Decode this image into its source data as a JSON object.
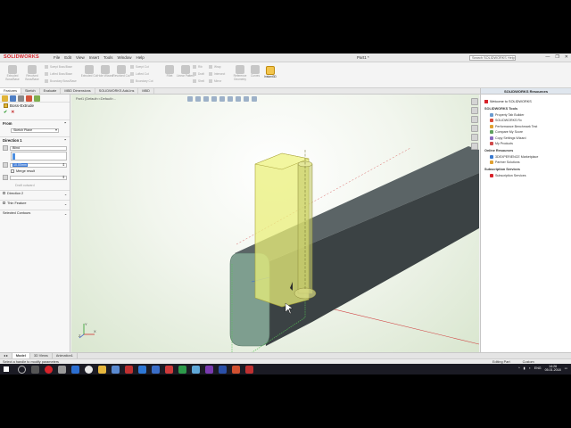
{
  "window": {
    "app_logo": "SOLIDWORKS",
    "menus": [
      "File",
      "Edit",
      "View",
      "Insert",
      "Tools",
      "Window",
      "Help"
    ],
    "doc_title": "Part1 *",
    "search_placeholder": "Search SOLIDWORKS Help",
    "controls": [
      "—",
      "❐",
      "✕"
    ]
  },
  "ribbon": {
    "groups": [
      {
        "label": "Extruded Boss/Base"
      },
      {
        "label": "Revolved Boss/Base"
      },
      {
        "label": "Extruded Cut"
      },
      {
        "label": "Hole Wizard"
      },
      {
        "label": "Revolved Cut"
      },
      {
        "label": "Fillet"
      },
      {
        "label": "Linear Pattern"
      },
      {
        "label": "Rib"
      },
      {
        "label": "Reference Geometry"
      },
      {
        "label": "Curves"
      }
    ],
    "small_items": [
      "Swept Boss/Base",
      "Lofted Boss/Base",
      "Boundary Boss/Base",
      "Swept Cut",
      "Lofted Cut",
      "Boundary Cut",
      "Draft",
      "Shell",
      "Wrap",
      "Intersect",
      "Mirror"
    ],
    "instant3d_label": "Instant3D"
  },
  "tabs": [
    "Features",
    "Sketch",
    "Evaluate",
    "MBD Dimensions",
    "SOLIDWORKS Add-Ins",
    "MBD"
  ],
  "active_tab": "Features",
  "property_manager": {
    "title": "Boss-Extrude",
    "ok": "✔",
    "cancel": "✕",
    "from_label": "From",
    "from_value": "Sketch Plane",
    "direction1_label": "Direction 1",
    "end_condition": "Blind",
    "depth_value": "10.00mm",
    "merge_result": "Merge result",
    "draft_outward": "Draft outward",
    "direction2_label": "Direction 2",
    "thin_feature_label": "Thin Feature",
    "selected_contours_label": "Selected Contours"
  },
  "graphics": {
    "breadcrumb": "Part1 (Default<<Default>...",
    "colors": {
      "bar_body": "#3b4244",
      "end_face": "#7e9e8f",
      "preview": "#e9ef7a",
      "preview_edge": "#a9a33a",
      "cylinder": "#c5c96a"
    },
    "axis_labels": {
      "x": "X",
      "y": "Y",
      "z": "Z"
    }
  },
  "resources": {
    "header": "SOLIDWORKS Resources",
    "welcome": "Welcome to SOLIDWORKS",
    "sections": [
      {
        "title": "SOLIDWORKS Tools",
        "items": [
          "Property Tab Builder",
          "SOLIDWORKS Rx",
          "Performance Benchmark Test",
          "Compare My Score",
          "Copy Settings Wizard",
          "My Products"
        ]
      },
      {
        "title": "Online Resources",
        "items": [
          "3DEXPERIENCE Marketplace",
          "Partner Solutions"
        ]
      },
      {
        "title": "Subscription Services",
        "items": [
          "Subscription Services"
        ]
      }
    ]
  },
  "model_tabs": [
    "Model",
    "3D Views",
    "Animation1"
  ],
  "status": {
    "left": "Select a handle to modify parameters",
    "editing": "Editing Part",
    "units": "Custom"
  },
  "taskbar": {
    "time": "14:26",
    "date": "05.01.2018",
    "lang": "ENG"
  }
}
